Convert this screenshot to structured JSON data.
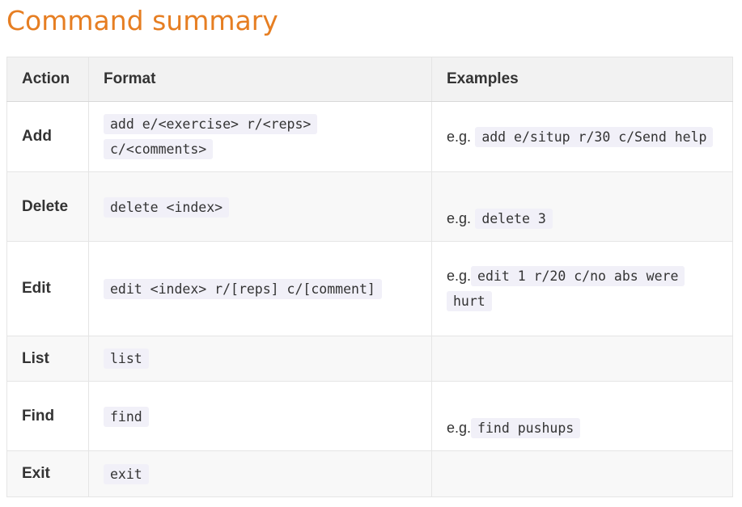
{
  "page_title": "Command summary",
  "table": {
    "headers": {
      "action": "Action",
      "format": "Format",
      "examples": "Examples"
    },
    "rows": [
      {
        "action": "Add",
        "format": "add e/<exercise> r/<reps> c/<comments>",
        "example_prefix": "e.g.",
        "example": "add e/situp r/30 c/Send help"
      },
      {
        "action": "Delete",
        "format": "delete <index>",
        "example_prefix": "e.g.",
        "example": "delete 3"
      },
      {
        "action": "Edit",
        "format": "edit <index> r/[reps] c/[comment]",
        "example_prefix": "e.g.",
        "example": "edit 1 r/20 c/no abs were hurt"
      },
      {
        "action": "List",
        "format": "list",
        "example_prefix": "",
        "example": ""
      },
      {
        "action": "Find",
        "format": "find",
        "example_prefix": "e.g.",
        "example": "find pushups"
      },
      {
        "action": "Exit",
        "format": "exit",
        "example_prefix": "",
        "example": ""
      }
    ]
  }
}
